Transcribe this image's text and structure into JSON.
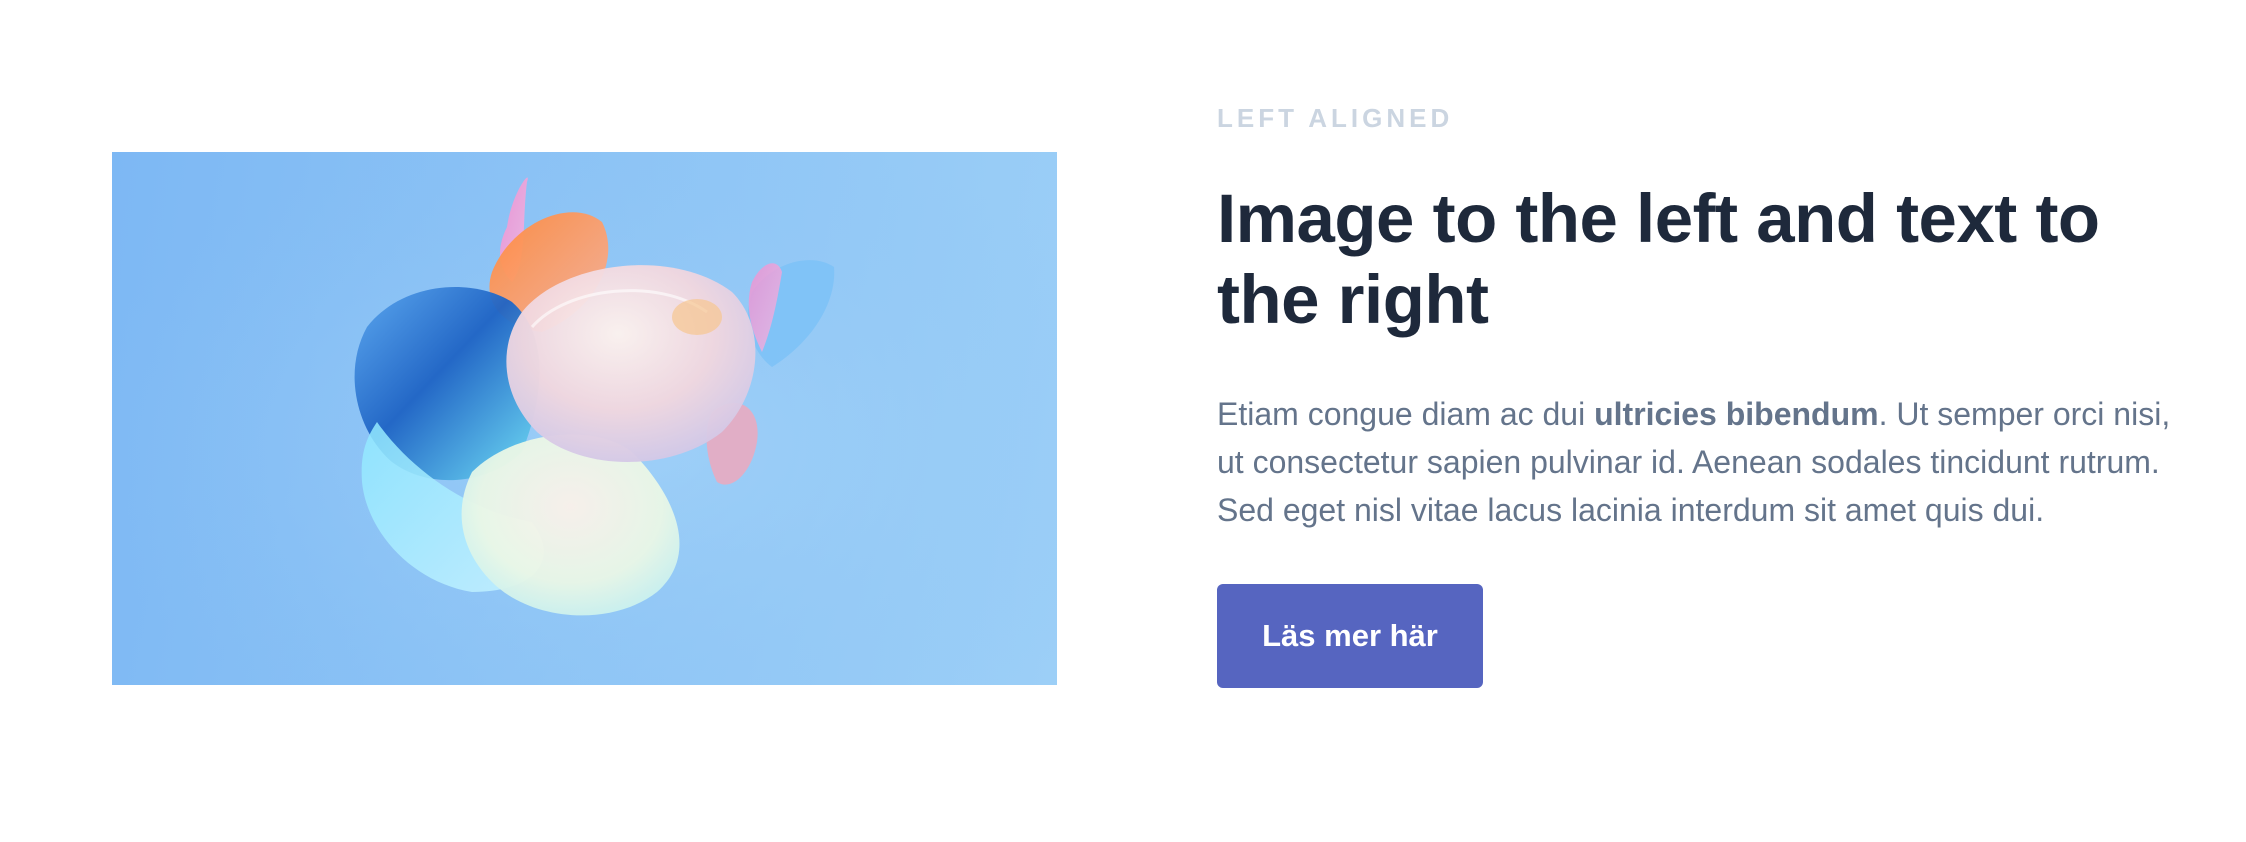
{
  "section": {
    "eyebrow": "LEFT ALIGNED",
    "heading": "Image to the left and text to the right",
    "body": {
      "before": "Etiam congue diam ac dui ",
      "bold": "ultricies bibendum",
      "after": ". Ut semper orci nisi, ut consectetur sapien pulvinar id. Aenean sodales tincidunt rutrum. Sed eget nisl vitae lacus lacinia interdum sit amet quis dui."
    },
    "button_label": "Läs mer här"
  },
  "colors": {
    "accent": "#5665c0",
    "heading": "#1e293b",
    "body": "#64748b",
    "eyebrow": "#cbd5e1",
    "image_background": "#8cc3f5"
  }
}
